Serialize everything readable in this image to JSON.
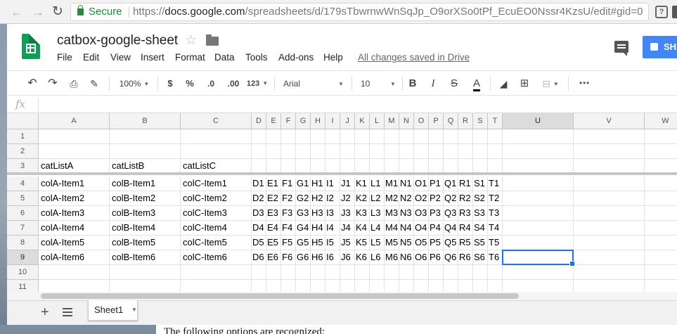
{
  "browser": {
    "secure_label": "Secure",
    "url_scheme": "https://",
    "url_host": "docs.google.com",
    "url_path": "/spreadsheets/d/179sTbwrnwWnSqJp_O9orXSo0tPf_EcuEO0Nssr4KzsU/edit#gid=0"
  },
  "doc": {
    "title": "catbox-google-sheet",
    "saved_status": "All changes saved in Drive",
    "share_label": "SHA"
  },
  "menu": [
    "File",
    "Edit",
    "View",
    "Insert",
    "Format",
    "Data",
    "Tools",
    "Add-ons",
    "Help"
  ],
  "toolbar": {
    "zoom": "100%",
    "currency": "$",
    "percent": "%",
    "decrease_decimal": ".0",
    "increase_decimal": ".00",
    "more_formats": "123",
    "font": "Arial",
    "font_size": "10",
    "bold": "B",
    "italic": "I",
    "strike": "S",
    "text_color": "A"
  },
  "formula_bar": {
    "fx": "fx"
  },
  "grid": {
    "columns": [
      "A",
      "B",
      "C",
      "D",
      "E",
      "F",
      "G",
      "H",
      "I",
      "J",
      "K",
      "L",
      "M",
      "N",
      "O",
      "P",
      "Q",
      "R",
      "S",
      "T",
      "U",
      "V",
      "W"
    ],
    "rows": [
      "1",
      "2",
      "3",
      "4",
      "5",
      "6",
      "7",
      "8",
      "9",
      "10",
      "11"
    ],
    "selected_column": "U",
    "selected_row": "9",
    "cells": [
      [
        "",
        "",
        ""
      ],
      [
        "",
        "",
        ""
      ],
      [
        "catListA",
        "catListB",
        "catListC"
      ],
      [
        "colA-Item1",
        "colB-Item1",
        "colC-Item1",
        "D1",
        "E1",
        "F1",
        "G1",
        "H1",
        "I1",
        "J1",
        "K1",
        "L1",
        "M1",
        "N1",
        "O1",
        "P1",
        "Q1",
        "R1",
        "S1",
        "T1"
      ],
      [
        "colA-Item2",
        "colB-Item2",
        "colC-Item2",
        "D2",
        "E2",
        "F2",
        "G2",
        "H2",
        "I2",
        "J2",
        "K2",
        "L2",
        "M2",
        "N2",
        "O2",
        "P2",
        "Q2",
        "R2",
        "S2",
        "T2"
      ],
      [
        "colA-Item3",
        "colB-Item3",
        "colC-Item3",
        "D3",
        "E3",
        "F3",
        "G3",
        "H3",
        "I3",
        "J3",
        "K3",
        "L3",
        "M3",
        "N3",
        "O3",
        "P3",
        "Q3",
        "R3",
        "S3",
        "T3"
      ],
      [
        "colA-Item4",
        "colB-Item4",
        "colC-Item4",
        "D4",
        "E4",
        "F4",
        "G4",
        "H4",
        "I4",
        "J4",
        "K4",
        "L4",
        "M4",
        "N4",
        "O4",
        "P4",
        "Q4",
        "R4",
        "S4",
        "T4"
      ],
      [
        "colA-Item5",
        "colB-Item5",
        "colC-Item5",
        "D5",
        "E5",
        "F5",
        "G5",
        "H5",
        "I5",
        "J5",
        "K5",
        "L5",
        "M5",
        "N5",
        "O5",
        "P5",
        "Q5",
        "R5",
        "S5",
        "T5"
      ],
      [
        "colA-Item6",
        "colB-Item6",
        "colC-Item6",
        "D6",
        "E6",
        "F6",
        "G6",
        "H6",
        "I6",
        "J6",
        "K6",
        "L6",
        "M6",
        "N6",
        "O6",
        "P6",
        "Q6",
        "R6",
        "S6",
        "T6"
      ],
      [],
      []
    ]
  },
  "sheets": {
    "tabs": [
      "Sheet1"
    ]
  },
  "background_text": "The following options are recognized:",
  "colors": {
    "accent": "#4285f4",
    "sheets_green": "#0f9d58",
    "secure_green": "#1e8a32",
    "selection": "#1a73e8"
  }
}
